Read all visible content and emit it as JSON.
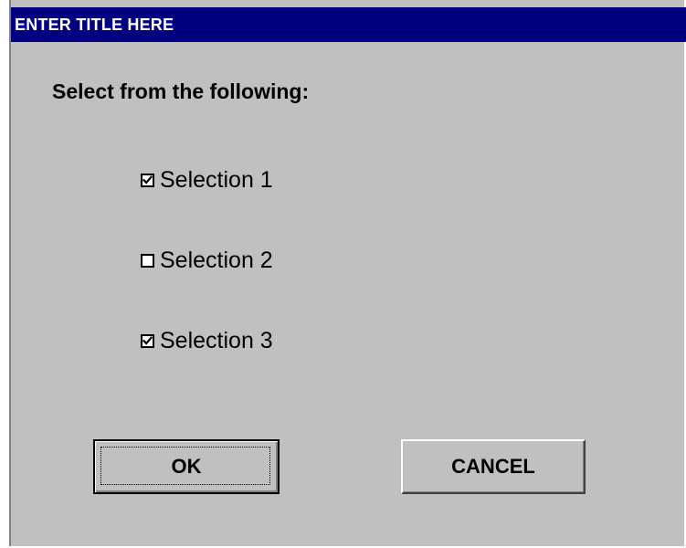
{
  "window": {
    "title": "ENTER TITLE HERE",
    "title_bar_color": "#000080",
    "background_color": "#c0c0c0"
  },
  "dialog": {
    "prompt": "Select from the following:",
    "options": [
      {
        "label": "Selection 1",
        "checked": true
      },
      {
        "label": "Selection 2",
        "checked": false
      },
      {
        "label": "Selection 3",
        "checked": true
      }
    ],
    "buttons": {
      "ok_label": "OK",
      "cancel_label": "CANCEL"
    }
  }
}
